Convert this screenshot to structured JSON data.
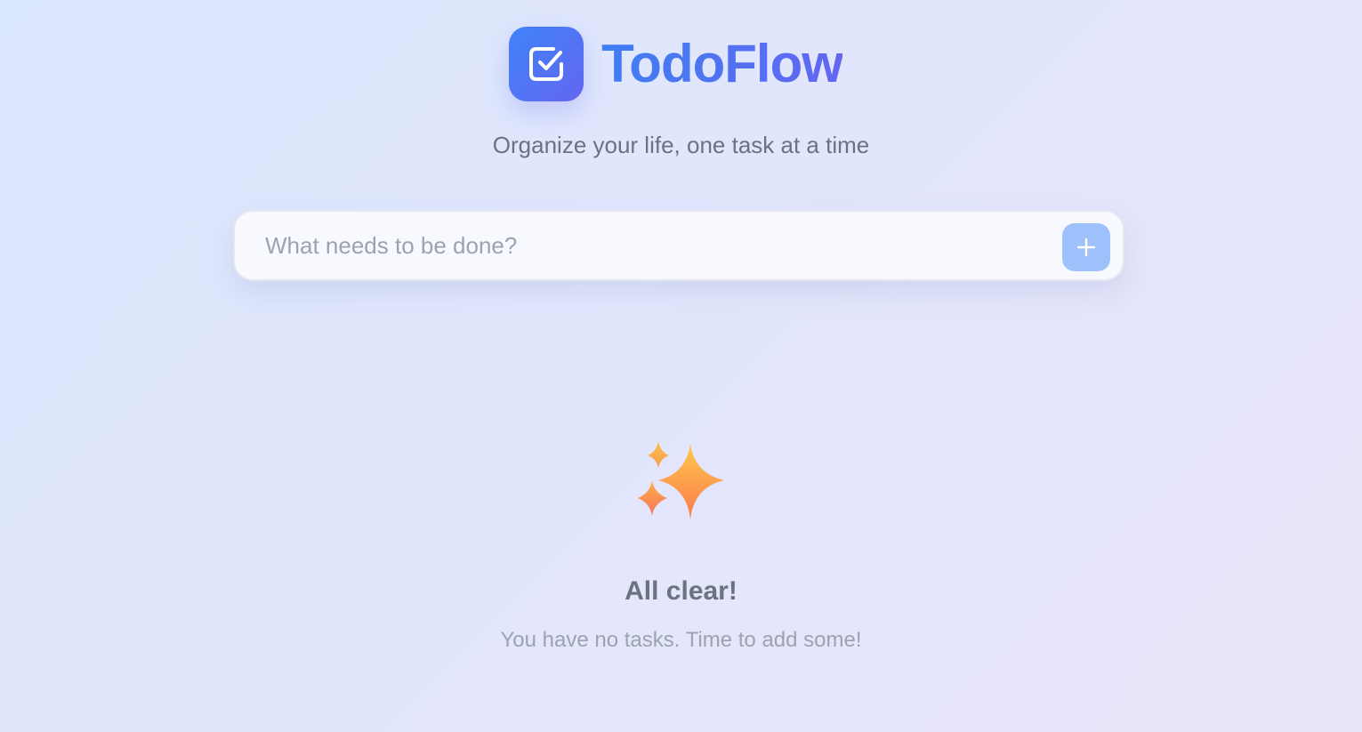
{
  "app": {
    "name": "TodoFlow",
    "tagline": "Organize your life, one task at a time"
  },
  "logo": {
    "icon": "checkbox-icon",
    "gradient": [
      "#3f83f8",
      "#6366f1"
    ]
  },
  "new_task": {
    "placeholder": "What needs to be done?",
    "value": "",
    "add_button_icon": "plus-icon",
    "add_button_color": "#9ec0fb"
  },
  "empty_state": {
    "icon": "sparkles-icon",
    "title": "All clear!",
    "message": "You have no tasks. Time to add some!"
  },
  "colors": {
    "background": [
      "#dbe7fd",
      "#eae5fb"
    ],
    "brand": "#4f74f4",
    "muted_text": "#6b7280",
    "placeholder_text": "#9ca3af"
  }
}
